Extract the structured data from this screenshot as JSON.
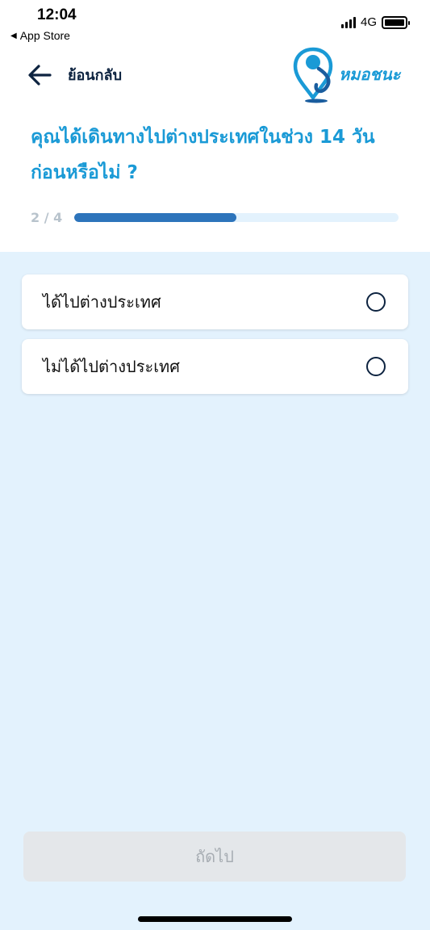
{
  "status_bar": {
    "time": "12:04",
    "back_app": "App Store",
    "network": "4G"
  },
  "header": {
    "back_label": "ย้อนกลับ",
    "logo_text": "หมอชนะ"
  },
  "question": "คุณได้เดินทางไปต่างประเทศในช่วง 14 วันก่อนหรือไม่ ?",
  "progress": {
    "label": "2 / 4",
    "fraction": 0.5
  },
  "options": [
    {
      "label": "ได้ไปต่างประเทศ",
      "selected": false
    },
    {
      "label": "ไม่ได้ไปต่างประเทศ",
      "selected": false
    }
  ],
  "next_button": {
    "label": "ถัดไป",
    "enabled": false
  },
  "colors": {
    "accent": "#1a9ad6",
    "progress": "#2d74bb",
    "background": "#e3f2fd"
  }
}
